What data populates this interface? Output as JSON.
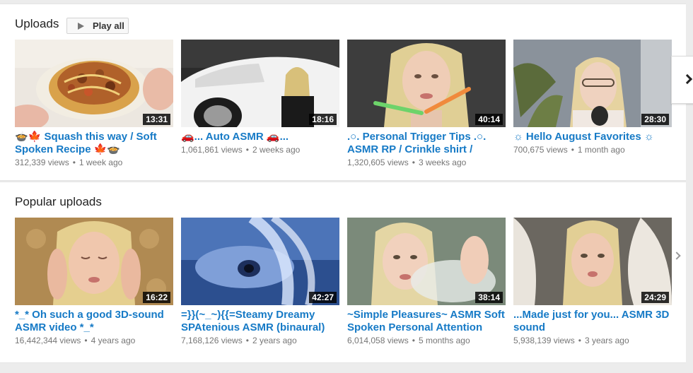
{
  "uploads": {
    "title": "Uploads",
    "play_all": "Play all",
    "videos": [
      {
        "title": "🍲🍁 Squash this way / Soft Spoken Recipe 🍁🍲",
        "views": "312,339 views",
        "age": "1 week ago",
        "duration": "13:31"
      },
      {
        "title": "🚗... Auto ASMR 🚗...",
        "views": "1,061,861 views",
        "age": "2 weeks ago",
        "duration": "18:16"
      },
      {
        "title": ".○. Personal Trigger Tips .○. ASMR RP / Crinkle shirt / Pape…",
        "views": "1,320,605 views",
        "age": "3 weeks ago",
        "duration": "40:14"
      },
      {
        "title": "☼ Hello August Favorites ☼",
        "views": "700,675 views",
        "age": "1 month ago",
        "duration": "28:30"
      }
    ]
  },
  "popular": {
    "title": "Popular uploads",
    "videos": [
      {
        "title": "*_* Oh such a good 3D-sound ASMR video *_*",
        "views": "16,442,344 views",
        "age": "4 years ago",
        "duration": "16:22"
      },
      {
        "title": "=}}(~_~){{=Steamy Dreamy SPAtenious ASMR (binaural)",
        "views": "7,168,126 views",
        "age": "2 years ago",
        "duration": "42:27"
      },
      {
        "title": "~Simple Pleasures~ ASMR Soft Spoken Personal Attention",
        "views": "6,014,058 views",
        "age": "5 months ago",
        "duration": "38:14"
      },
      {
        "title": "...Made just for you... ASMR 3D sound",
        "views": "5,938,139 views",
        "age": "3 years ago",
        "duration": "24:29"
      }
    ]
  },
  "icons": {
    "play": "play-icon",
    "next": "chevron-right-icon"
  },
  "colors": {
    "link": "#167ac6",
    "meta": "#767676",
    "background": "#ececec"
  }
}
